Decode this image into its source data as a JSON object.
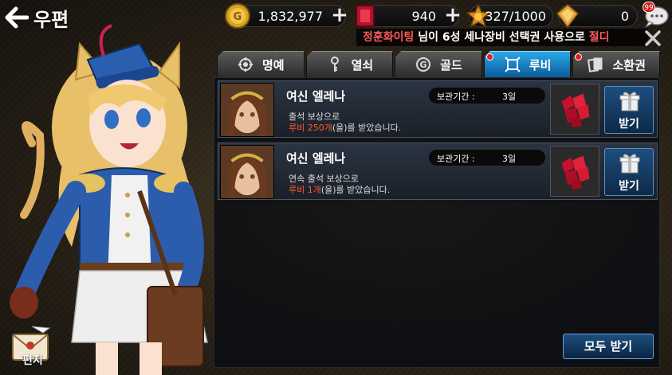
{
  "header": {
    "back_label": "우편"
  },
  "resources": {
    "gold": "1,832,977",
    "ruby": "940",
    "stamina": "327/1000",
    "gem": "0"
  },
  "chat": {
    "badge": "99"
  },
  "ticker": {
    "name": "정훈화이팅",
    "message": " 님이 6성 세나장비 선택권 사용으로 ",
    "tail": "절디"
  },
  "tabs": [
    {
      "label": "명예",
      "icon": "honor-icon",
      "active": false,
      "dot": false
    },
    {
      "label": "열쇠",
      "icon": "key-icon",
      "active": false,
      "dot": false
    },
    {
      "label": "골드",
      "icon": "gold-icon",
      "active": false,
      "dot": false
    },
    {
      "label": "루비",
      "icon": "ruby-tab-icon",
      "active": true,
      "dot": true
    },
    {
      "label": "소환권",
      "icon": "summon-ticket-icon",
      "active": false,
      "dot": true
    }
  ],
  "mails": [
    {
      "sender": "여신 엘레나",
      "line1": "출석 보상으로",
      "line2_highlight": "루비 250개",
      "line2_rest": "(을)를 받았습니다.",
      "keep_label": "보관기간 :",
      "keep_value": "3일",
      "claim_label": "받기"
    },
    {
      "sender": "여신 엘레나",
      "line1": "연속 출석 보상으로",
      "line2_highlight": "루비 1개",
      "line2_rest": "(을)를 받았습니다.",
      "keep_label": "보관기간 :",
      "keep_value": "3일",
      "claim_label": "받기"
    }
  ],
  "footer": {
    "claim_all": "모두 받기",
    "edit_label": "편지"
  }
}
